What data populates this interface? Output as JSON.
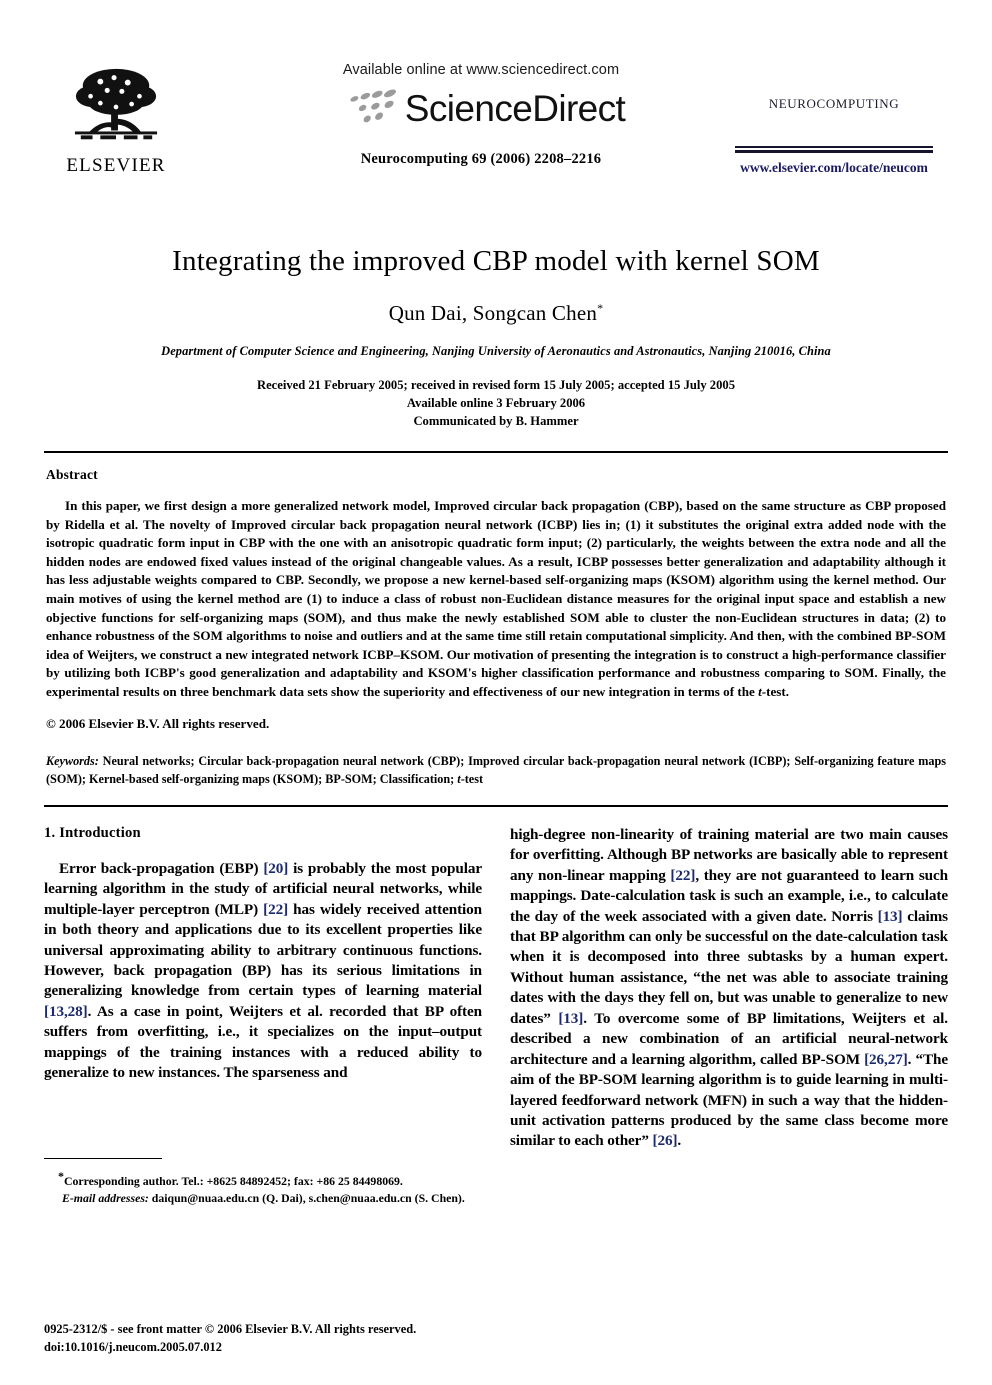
{
  "masthead": {
    "publisher_name": "ELSEVIER",
    "available_online": "Available online at www.sciencedirect.com",
    "sciencedirect_wordmark": "ScienceDirect",
    "journal_citation": "Neurocomputing 69 (2006) 2208–2216",
    "journal_brand": "Neurocomputing",
    "journal_url": "www.elsevier.com/locate/neucom"
  },
  "article": {
    "title": "Integrating the improved CBP model with kernel SOM",
    "authors": "Qun Dai, Songcan Chen",
    "corresponding_marker": "*",
    "affiliation": "Department of Computer Science and Engineering, Nanjing University of Aeronautics and Astronautics, Nanjing 210016, China",
    "received": "Received 21 February 2005; received in revised form 15 July 2005; accepted 15 July 2005",
    "available_online": "Available online 3 February 2006",
    "communicated_by": "Communicated by B. Hammer"
  },
  "abstract": {
    "heading": "Abstract",
    "text": "In this paper, we first design a more generalized network model, Improved circular back propagation (CBP), based on the same structure as CBP proposed by Ridella et al. The novelty of Improved circular back propagation neural network (ICBP) lies in; (1) it substitutes the original extra added node with the isotropic quadratic form input in CBP with the one with an anisotropic quadratic form input; (2) particularly, the weights between the extra node and all the hidden nodes are endowed fixed values instead of the original changeable values. As a result, ICBP possesses better generalization and adaptability although it has less adjustable weights compared to CBP. Secondly, we propose a new kernel-based self-organizing maps (KSOM) algorithm using the kernel method. Our main motives of using the kernel method are (1) to induce a class of robust non-Euclidean distance measures for the original input space and establish a new objective functions for self-organizing maps (SOM), and thus make the newly established SOM able to cluster the non-Euclidean structures in data; (2) to enhance robustness of the SOM algorithms to noise and outliers and at the same time still retain computational simplicity. And then, with the combined BP-SOM idea of Weijters, we construct a new integrated network ICBP–KSOM. Our motivation of presenting the integration is to construct a high-performance classifier by utilizing both ICBP's good generalization and adaptability and KSOM's higher classification performance and robustness comparing to SOM. Finally, the experimental results on three benchmark data sets show the superiority and effectiveness of our new integration in terms of the ",
    "text_tail": "-test.",
    "italic_in_tail": "t",
    "copyright": "© 2006 Elsevier B.V. All rights reserved."
  },
  "keywords": {
    "label": "Keywords:",
    "text": " Neural networks; Circular back-propagation neural network (CBP); Improved circular back-propagation neural network (ICBP); Self-organizing feature maps (SOM); Kernel-based self-organizing maps (KSOM); BP-SOM; Classification; ",
    "last_italic": "t",
    "last_tail": "-test"
  },
  "introduction": {
    "heading": "1.  Introduction",
    "left_par_1_a": "Error back-propagation (EBP) ",
    "left_ref_1": "[20]",
    "left_par_1_b": " is probably the most popular learning algorithm in the study of artificial neural networks, while multiple-layer perceptron (MLP) ",
    "left_ref_2": "[22]",
    "left_par_1_c": " has widely received attention in both theory and applications due to its excellent properties like universal approximating ability to arbitrary continuous functions. However, back propagation (BP) has its serious limitations in generalizing knowledge from certain types of learning material ",
    "left_ref_3": "[13,28]",
    "left_par_1_d": ". As a case in point, Weijters et al. recorded that BP often suffers from overfitting, i.e., it specializes on the input–output mappings of the training instances with a reduced ability to generalize to new instances. The sparseness and",
    "right_par_a": "high-degree non-linearity of training material are two main causes for overfitting. Although BP networks are basically able to represent any non-linear mapping ",
    "right_ref_1": "[22]",
    "right_par_b": ", they are not guaranteed to learn such mappings. Date-calculation task is such an example, i.e., to calculate the day of the week associated with a given date. Norris ",
    "right_ref_2": "[13]",
    "right_par_c": " claims that BP algorithm can only be successful on the date-calculation task when it is decomposed into three subtasks by a human expert. Without human assistance, “the net was able to associate training dates with the days they fell on, but was unable to generalize to new dates” ",
    "right_ref_3": "[13]",
    "right_par_d": ". To overcome some of BP limitations, Weijters et al. described a new combination of an artificial neural-network architecture and a learning algorithm, called BP-SOM ",
    "right_ref_4": "[26,27]",
    "right_par_e": ". “The aim of the BP-SOM learning algorithm is to guide learning in multi-layered feedforward network (MFN) in such a way that the hidden-unit activation patterns produced by the same class become more similar to each other” ",
    "right_ref_5": "[26]",
    "right_par_f": "."
  },
  "footnote": {
    "corresponding": "Corresponding author. Tel.: +8625 84892452; fax: +86 25 84498069.",
    "email_label": "E-mail addresses:",
    "email_text": " daiqun@nuaa.edu.cn (Q. Dai), s.chen@nuaa.edu.cn (S. Chen)."
  },
  "page_footer": {
    "front_matter": "0925-2312/$ - see front matter © 2006 Elsevier B.V. All rights reserved.",
    "doi": "doi:10.1016/j.neucom.2005.07.012"
  },
  "colors": {
    "reference_link": "#1c2a6b",
    "journal_url": "#1a1a5e",
    "rule": "#000000",
    "logo_gray": "#9b9b9b"
  }
}
